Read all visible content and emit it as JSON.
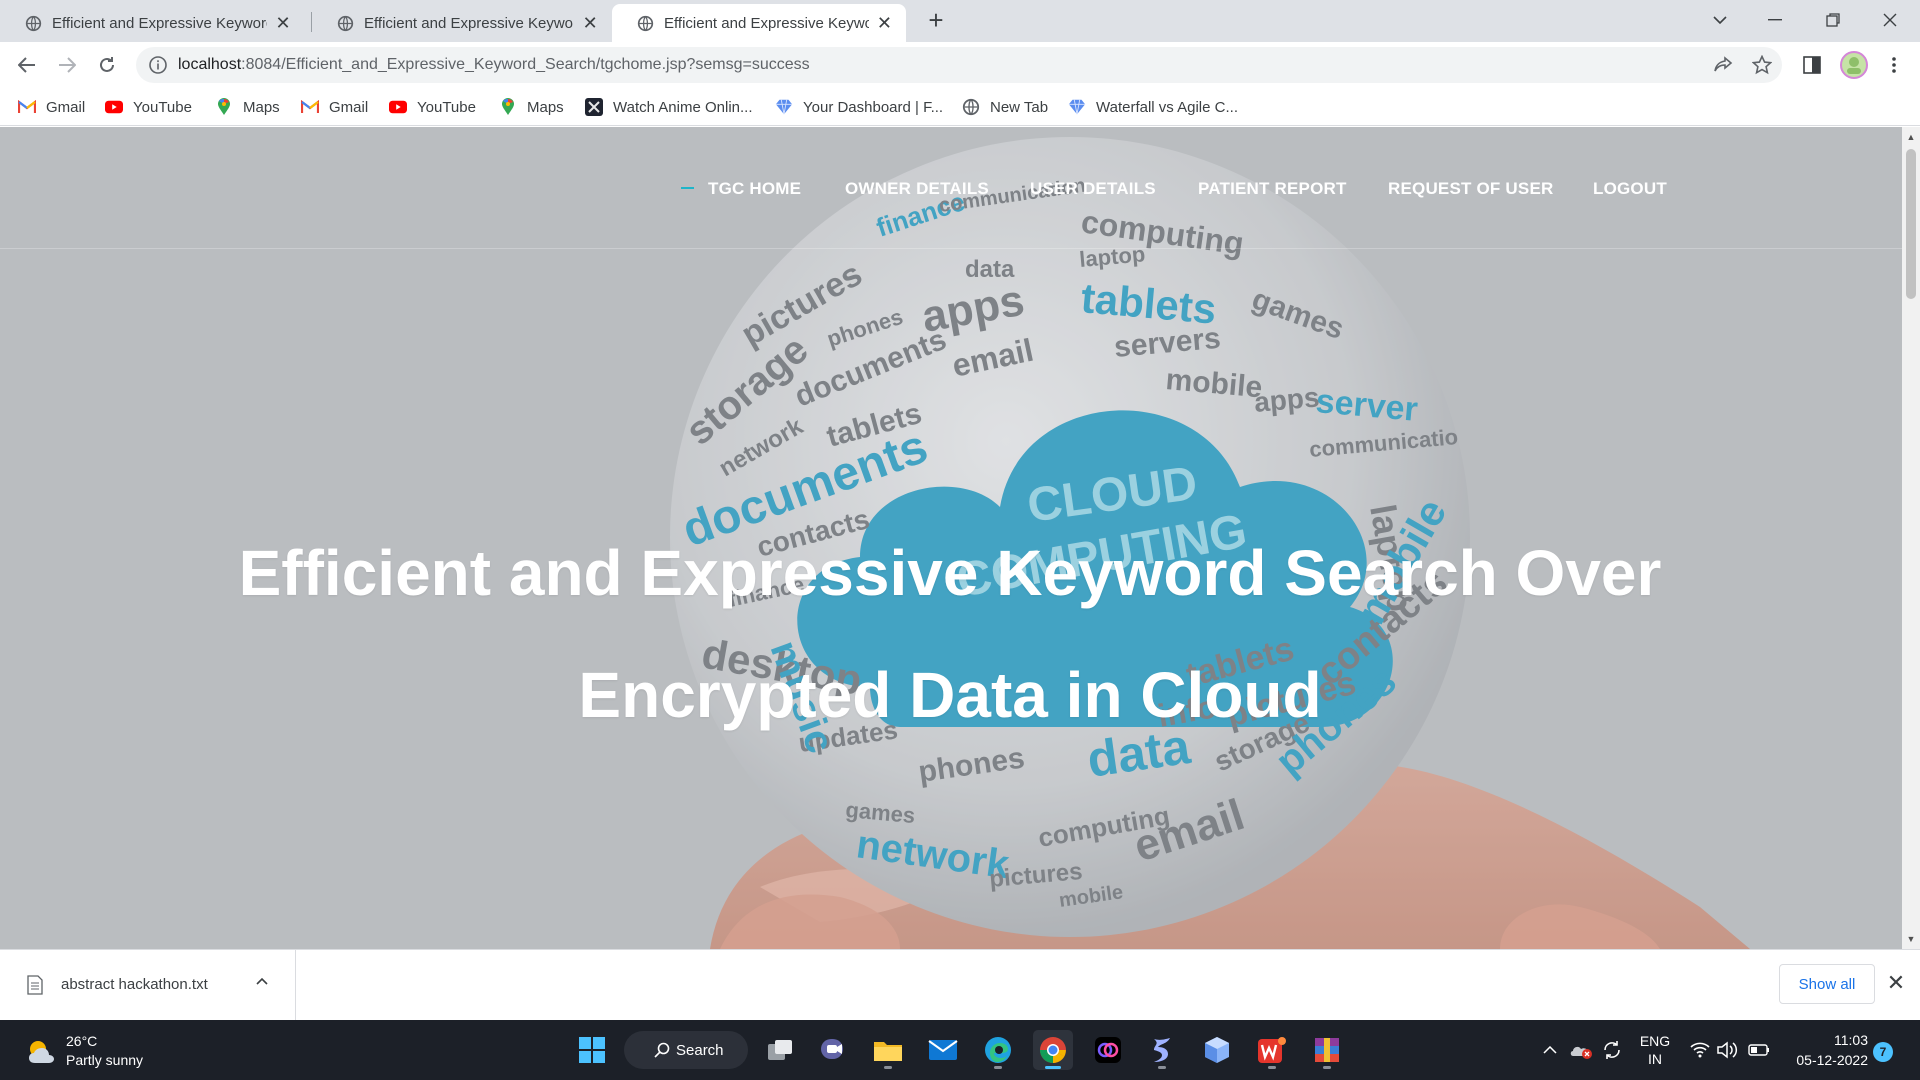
{
  "browser": {
    "tabs": [
      {
        "title": "Efficient and Expressive Keyword",
        "active": false
      },
      {
        "title": "Efficient and Expressive Keyword",
        "active": false
      },
      {
        "title": "Efficient and Expressive Keyword",
        "active": true
      }
    ],
    "url_host": "localhost",
    "url_rest": ":8084/Efficient_and_Expressive_Keyword_Search/tgchome.jsp?semsg=success",
    "bookmarks": [
      {
        "label": "Gmail",
        "icon": "gmail-icon"
      },
      {
        "label": "YouTube",
        "icon": "youtube-icon"
      },
      {
        "label": "Maps",
        "icon": "maps-icon"
      },
      {
        "label": "Gmail",
        "icon": "gmail-icon"
      },
      {
        "label": "YouTube",
        "icon": "youtube-icon"
      },
      {
        "label": "Maps",
        "icon": "maps-icon"
      },
      {
        "label": "Watch Anime Onlin...",
        "icon": "anime-icon"
      },
      {
        "label": "Your Dashboard | F...",
        "icon": "diamond-icon"
      },
      {
        "label": "New Tab",
        "icon": "globe-icon"
      },
      {
        "label": "Waterfall vs Agile C...",
        "icon": "diamond-icon"
      }
    ]
  },
  "site": {
    "nav": [
      "TGC HOME",
      "OWNER DETAILS",
      "USER DETAILS",
      "PATIENT REPORT",
      "REQUEST OF USER",
      "LOGOUT"
    ],
    "hero_title_line1": "Efficient and Expressive Keyword Search Over",
    "hero_title_line2": "Encrypted Data in Cloud",
    "sphere_words": [
      "finance",
      "communication",
      "computing",
      "data",
      "laptop",
      "pictures",
      "phones",
      "apps",
      "tablets",
      "games",
      "storage",
      "documents",
      "email",
      "servers",
      "network",
      "tablets",
      "mobile",
      "apps",
      "server",
      "documents",
      "contacts",
      "finance",
      "laptop",
      "updates",
      "phones",
      "games",
      "data",
      "storage",
      "network",
      "computing",
      "email",
      "pictures",
      "mobile",
      "tablets",
      "info",
      "contacts",
      "phones",
      "music",
      "CLOUD",
      "COMPUTING"
    ]
  },
  "downloads": {
    "file": "abstract hackathon.txt",
    "show_all": "Show all"
  },
  "taskbar": {
    "temp": "26°C",
    "condition": "Partly sunny",
    "search": "Search",
    "lang1": "ENG",
    "lang2": "IN",
    "time": "11:03",
    "date": "05-12-2022",
    "notifications": "7"
  },
  "colors": {
    "accent": "#1fb5c9",
    "cloud": "#1e98c0",
    "chrome_blue": "#1a73e8"
  }
}
